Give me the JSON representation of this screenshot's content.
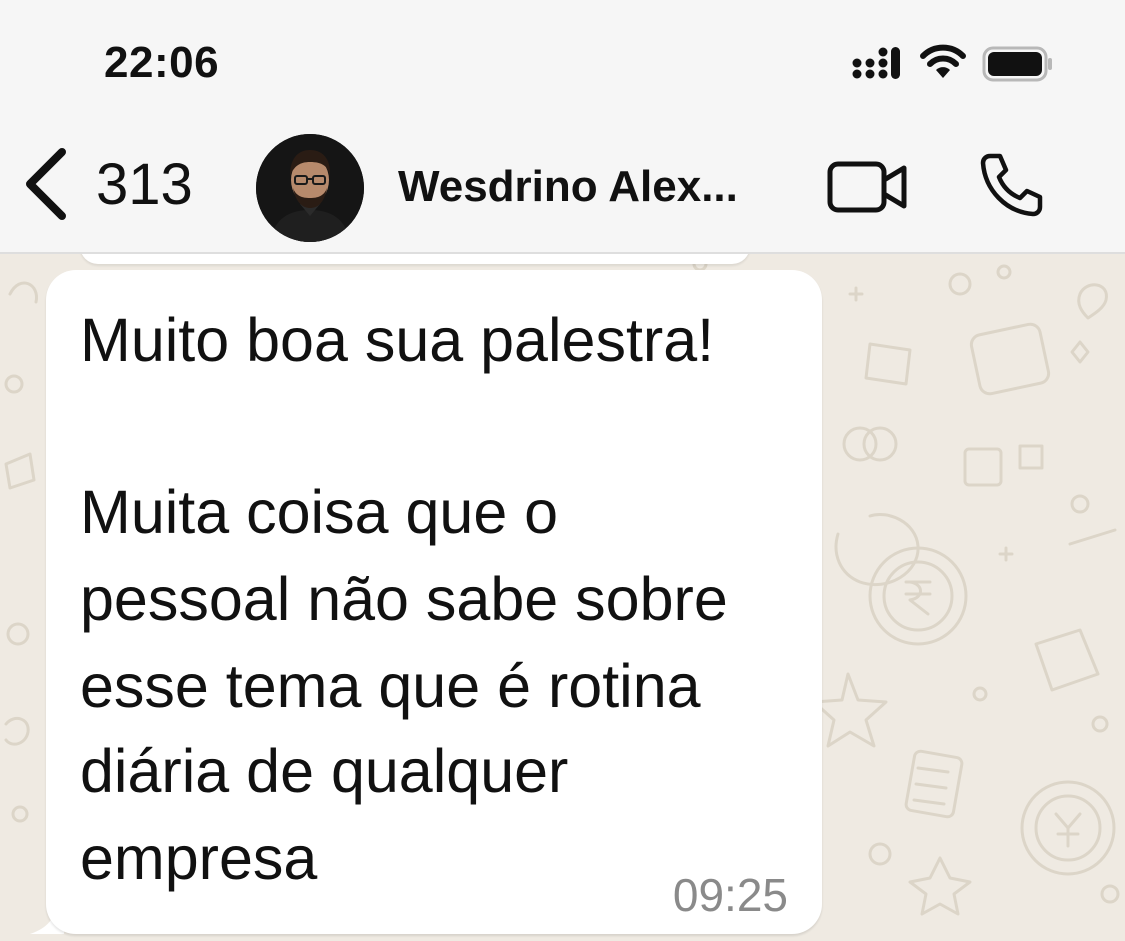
{
  "status_bar": {
    "time": "22:06"
  },
  "header": {
    "back_count": "313",
    "contact_name": "Wesdrino Alex..."
  },
  "message": {
    "lines": [
      "Muito boa sua palestra!",
      "",
      "Muita coisa que o",
      "pessoal não sabe sobre",
      "esse tema que é rotina",
      "diária de qualquer",
      "empresa"
    ],
    "time": "09:25"
  },
  "colors": {
    "header_bg": "#f6f6f6",
    "chat_bg": "#efeae2",
    "bubble_bg": "#ffffff",
    "timestamp": "#8a8a8a"
  },
  "icons": {
    "back": "chevron-left-icon",
    "video": "video-camera-icon",
    "call": "phone-icon",
    "signal": "cellular-signal-icon",
    "wifi": "wifi-icon",
    "battery": "battery-icon"
  }
}
